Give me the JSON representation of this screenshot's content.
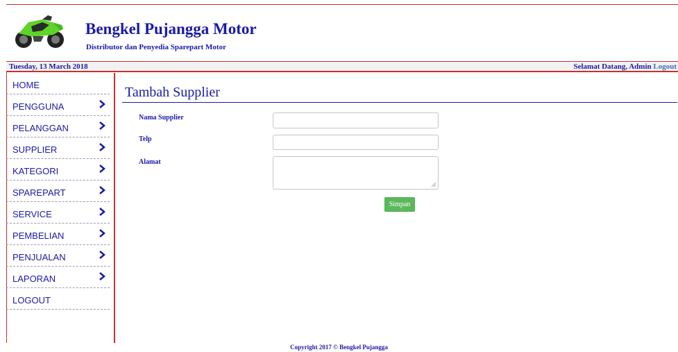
{
  "header": {
    "title": "Bengkel Pujangga Motor",
    "subtitle": "Distributor dan Penyedia Sparepart Motor"
  },
  "datebar": {
    "date": "Tuesday, 13 March 2018",
    "welcome": "Selamat Datang, Admin",
    "logout": "Logout"
  },
  "sidebar": {
    "items": [
      {
        "label": "HOME",
        "has_chevron": false
      },
      {
        "label": "PENGGUNA",
        "has_chevron": true
      },
      {
        "label": "PELANGGAN",
        "has_chevron": true
      },
      {
        "label": "SUPPLIER",
        "has_chevron": true
      },
      {
        "label": "KATEGORI",
        "has_chevron": true
      },
      {
        "label": "SPAREPART",
        "has_chevron": true
      },
      {
        "label": "SERVICE",
        "has_chevron": true
      },
      {
        "label": "PEMBELIAN",
        "has_chevron": true
      },
      {
        "label": "PENJUALAN",
        "has_chevron": true
      },
      {
        "label": "LAPORAN",
        "has_chevron": true
      },
      {
        "label": "LOGOUT",
        "has_chevron": false
      }
    ]
  },
  "main": {
    "title": "Tambah Supplier",
    "form": {
      "nama_label": "Nama Supplier",
      "nama_value": "",
      "telp_label": "Telp",
      "telp_value": "",
      "alamat_label": "Alamat",
      "alamat_value": "",
      "submit_label": "Simpan"
    }
  },
  "footer": {
    "text": "Copyright 2017 © Bengkel Pujangga"
  },
  "colors": {
    "brand": "#1a1aa6",
    "accent_border": "#c9302c",
    "button": "#5cb85c"
  },
  "icons": {
    "logo": "motorcycle-logo",
    "menu_chevron": "chevron-right-icon"
  }
}
